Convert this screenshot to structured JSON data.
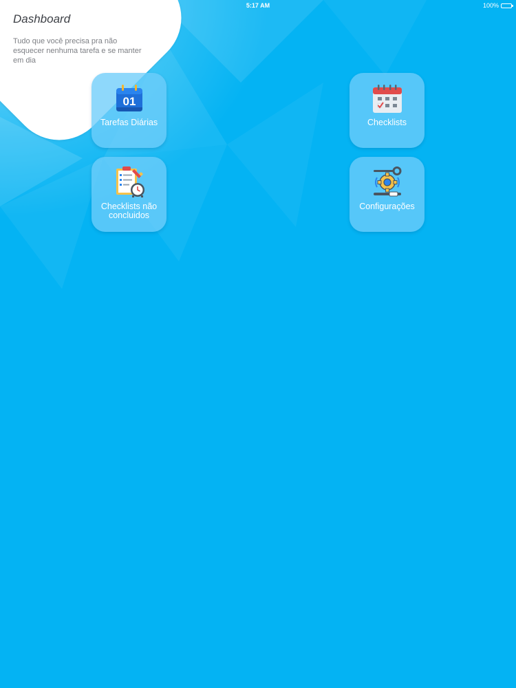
{
  "status_bar": {
    "time": "5:17 AM",
    "battery": "100%"
  },
  "header": {
    "title": "Dashboard",
    "subtitle": "Tudo que você precisa pra não esquecer nenhuma tarefa e se manter em dia"
  },
  "tiles": [
    {
      "label": "Tarefas Diárias",
      "icon": "calendar-day-icon",
      "icon_text": "01"
    },
    {
      "label": "Checklists",
      "icon": "calendar-grid-icon"
    },
    {
      "label": "Checklists não concluidos",
      "icon": "clipboard-clock-icon"
    },
    {
      "label": "Configurações",
      "icon": "gear-wrench-icon"
    }
  ],
  "colors": {
    "background": "#04b3f3",
    "tile": "#6ecdfa",
    "header_card": "#ffffff",
    "title_text": "#3d4046",
    "subtitle_text": "#7d7f84"
  }
}
